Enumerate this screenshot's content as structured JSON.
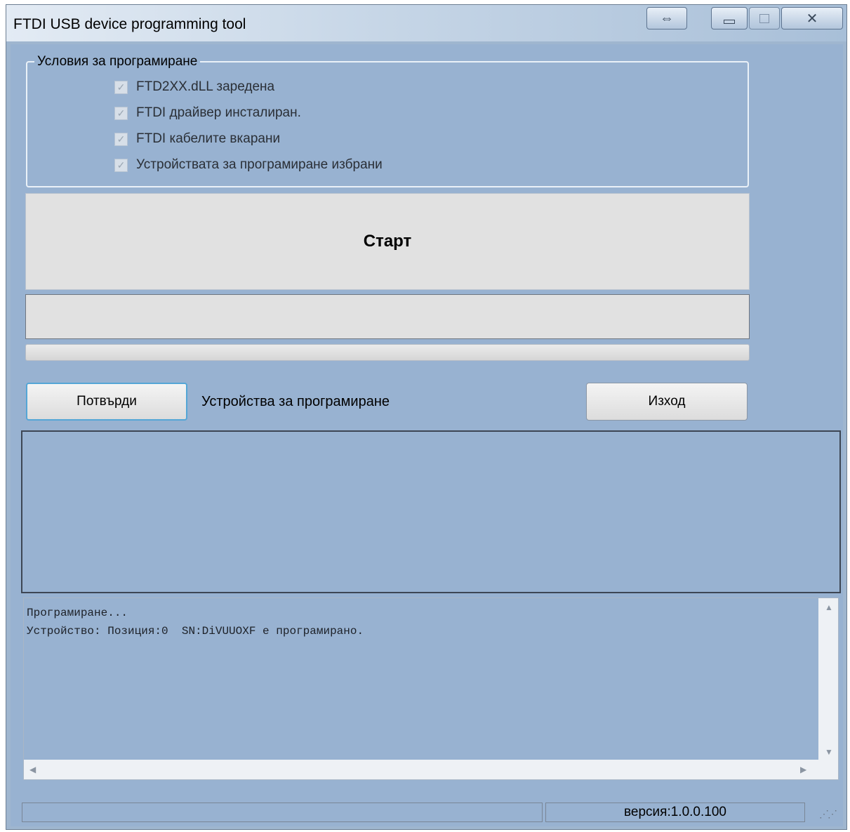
{
  "window": {
    "title": "FTDI USB device programming tool"
  },
  "conditions": {
    "legend": "Условия за програмиране",
    "items": [
      {
        "label": "FTD2XX.dLL заредена",
        "checked": true
      },
      {
        "label": "FTDI драйвер инсталиран.",
        "checked": true
      },
      {
        "label": "FTDI кабелите вкарани",
        "checked": true
      },
      {
        "label": "Устройствата за програмиране избрани",
        "checked": true
      }
    ]
  },
  "start_button": {
    "label": "Старт"
  },
  "confirm_button": {
    "label": "Потвърди"
  },
  "devices_label": "Устройства за програмиране",
  "exit_button": {
    "label": "Изход"
  },
  "log": {
    "lines": [
      "Програмиране...",
      "Устройство: Позиция:0  SN:DiVUUOXF е програмирано."
    ]
  },
  "status": {
    "version": "версия:1.0.0.100"
  },
  "icons": {
    "resize": "resize-arrows-icon",
    "minimize": "minimize-icon",
    "maximize": "maximize-icon",
    "close": "close-icon",
    "check": "checkmark-icon",
    "scroll_up": "scroll-up-arrow-icon",
    "scroll_down": "scroll-down-arrow-icon",
    "scroll_left": "scroll-left-arrow-icon",
    "scroll_right": "scroll-right-arrow-icon",
    "grip": "size-grip-icon"
  }
}
